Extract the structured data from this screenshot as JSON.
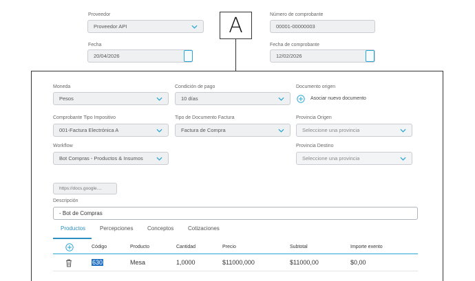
{
  "header": {
    "proveedor": {
      "label": "Proveedor",
      "value": "Proveedor API"
    },
    "numero_comprobante": {
      "label": "Número de comprobante",
      "value": "00001-00000003"
    },
    "fecha": {
      "label": "Fecha",
      "value": "20/04/2026"
    },
    "fecha_comprobante": {
      "label": "Fecha de comprobante",
      "value": "12/02/2026"
    }
  },
  "annotation": {
    "letter": "A"
  },
  "form": {
    "moneda": {
      "label": "Moneda",
      "value": "Pesos"
    },
    "condicion_pago": {
      "label": "Condición de pago",
      "value": "10 días"
    },
    "documento_origen": {
      "label": "Documento origen",
      "link": "Asociar nuevo documento"
    },
    "comprobante_tipo": {
      "label": "Comprobante Tipo Impositivo",
      "value": "001-Factura Electrónica A"
    },
    "tipo_documento": {
      "label": "Tipo de Documento Factura",
      "value": "Factura de Compra"
    },
    "provincia_origen": {
      "label": "Provincia Origen",
      "placeholder": "Seleccione una provincia"
    },
    "workflow": {
      "label": "Workflow",
      "value": "Bot Compras - Productos & Insumos"
    },
    "provincia_destino": {
      "label": "Provincia Destino",
      "placeholder": "Seleccione una provincia"
    },
    "url": "https://docs.google....",
    "descripcion": {
      "label": "Descripción",
      "value": "- Bot de Compras"
    }
  },
  "tabs": [
    "Productos",
    "Percepciones",
    "Conceptos",
    "Cotizaciones"
  ],
  "active_tab": "Productos",
  "table": {
    "headers": [
      "Código",
      "Producto",
      "Cantidad",
      "Precio",
      "Subtotal",
      "Importe exento"
    ],
    "rows": [
      {
        "codigo": "630",
        "producto": "Mesa",
        "cantidad": "1,0000",
        "precio": "$11000,000",
        "subtotal": "$11000,00",
        "importe_exento": "$0,00"
      }
    ]
  },
  "colors": {
    "accent": "#2aa6d6",
    "tab_active": "#2a8fc0",
    "selection": "#1f6fc2"
  }
}
